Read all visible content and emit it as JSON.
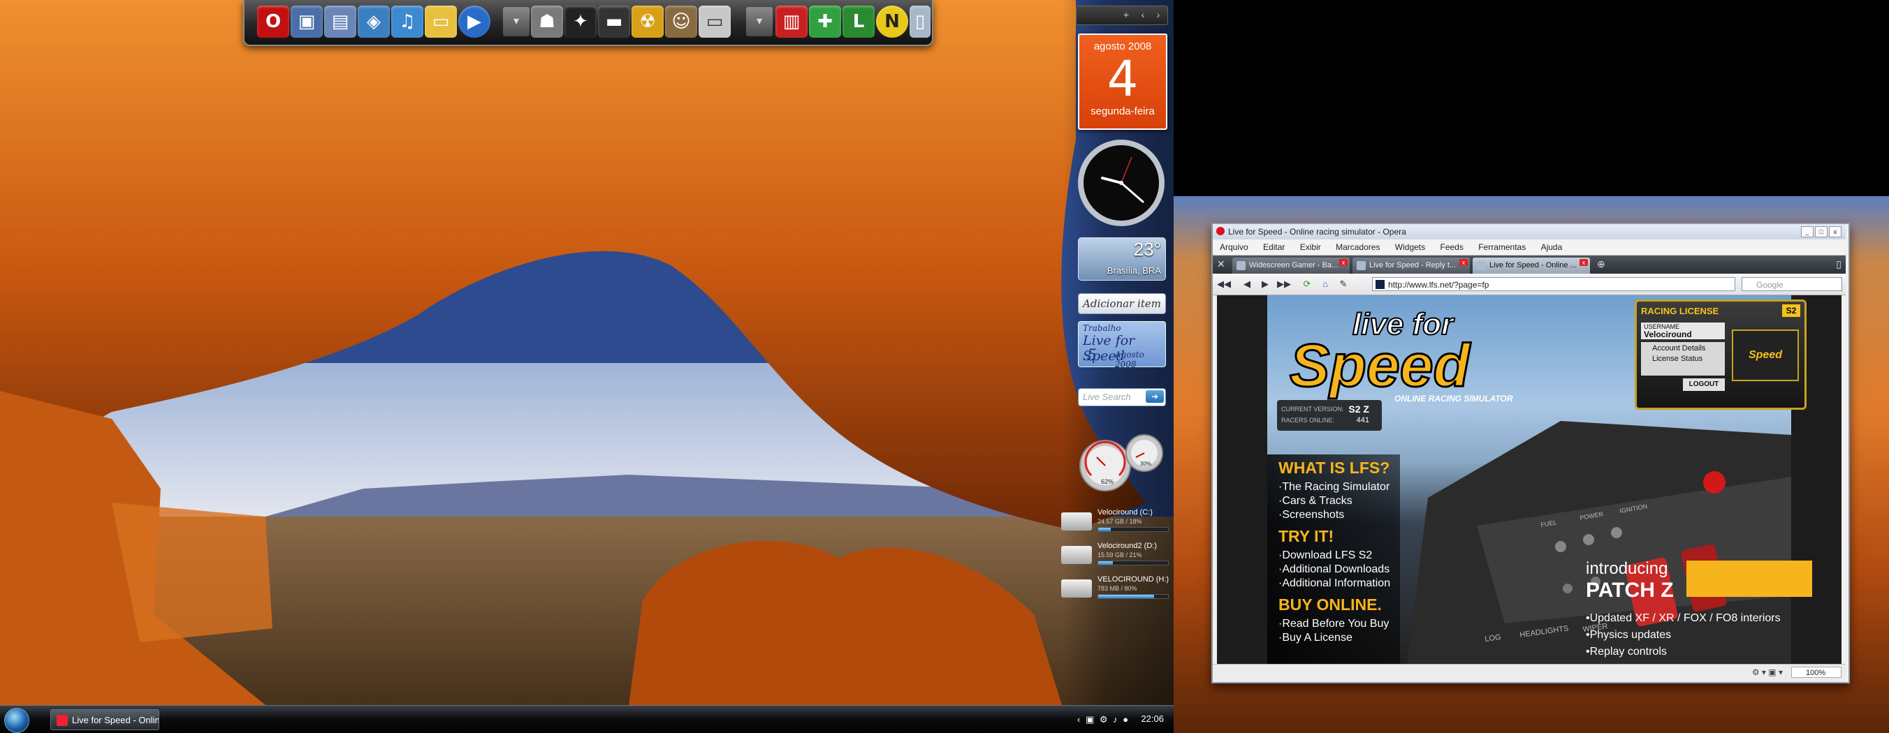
{
  "desktop": {
    "dock": {
      "icons": [
        "opera-icon",
        "computer-icon",
        "documents-icon",
        "media-icon",
        "music-icon",
        "folder-icon",
        "media-player-icon",
        "separator",
        "game-icon",
        "battlefield-icon",
        "racing-game-icon",
        "speed-icon",
        "radiation-icon",
        "character-icon",
        "drive-icon",
        "separator",
        "winamp-icon",
        "puzzle-icon",
        "program-icon",
        "norton-icon",
        "recycle-bin-icon"
      ]
    },
    "sidebar": {
      "top_controls": [
        "+",
        "‹",
        "›"
      ],
      "calendar": {
        "month": "agosto 2008",
        "day": "4",
        "weekday": "segunda-feira"
      },
      "weather": {
        "temp": "23°",
        "city": "Brasília, BRA"
      },
      "add_item": "Adicionar item",
      "note": {
        "title": "Trabalho",
        "line": "Live for Speed",
        "num": "5",
        "date": "Agosto 2008"
      },
      "live_search_placeholder": "Live Search",
      "gauges": {
        "cpu": "62%",
        "ram": "30%"
      },
      "drives": [
        {
          "name": "Velociround (C:)",
          "size": "24.57 GB / 18%",
          "usage": 0.18
        },
        {
          "name": "Velociround2 (D:)",
          "size": "15.59 GB / 21%",
          "usage": 0.21
        },
        {
          "name": "VELOCIROUND (H:)",
          "size": "783 MB / 80%",
          "usage": 0.8
        }
      ]
    },
    "taskbar": {
      "task_label": "Live for Speed - Onlin...",
      "clock": "22:06"
    }
  },
  "browser": {
    "title": "Live for Speed - Online racing simulator - Opera",
    "menu": [
      "Arquivo",
      "Editar",
      "Exibir",
      "Marcadores",
      "Widgets",
      "Feeds",
      "Ferramentas",
      "Ajuda"
    ],
    "tabs": [
      {
        "label": "Widescreen Gamer - Ba..."
      },
      {
        "label": "Live for Speed - Reply t..."
      },
      {
        "label": "Live for Speed - Online ..."
      }
    ],
    "url": "http://www.lfs.net/?page=fp",
    "search_placeholder": "Google",
    "zoom": "100%"
  },
  "lfs": {
    "logo_top": "live for",
    "logo_main": "Speed",
    "tagline": "ONLINE RACING SIMULATOR",
    "current_version_label": "CURRENT VERSION:",
    "current_version": "S2 Z",
    "racers_label": "RACERS ONLINE:",
    "racers": "441",
    "sections": [
      {
        "title": "WHAT IS LFS?",
        "links": [
          "·The Racing Simulator",
          "·Cars & Tracks",
          "·Screenshots"
        ]
      },
      {
        "title": "TRY IT!",
        "links": [
          "·Download LFS S2",
          "·Additional Downloads",
          "·Additional Information"
        ]
      },
      {
        "title": "BUY ONLINE.",
        "links": [
          "·Read Before You Buy",
          "·Buy A License"
        ]
      }
    ],
    "license": {
      "title": "RACING LICENSE",
      "badge": "S2",
      "username_label": "USERNAME",
      "username": "Velociround",
      "links": [
        "Account Details",
        "License Status"
      ],
      "logout": "LOGOUT",
      "mini_logo": "Speed"
    },
    "patch": {
      "intro": "introducing",
      "title": "PATCH Z",
      "items": [
        "•Updated XF / XR / FOX / FO8 interiors",
        "•Physics updates",
        "•Replay controls"
      ]
    },
    "dash_labels": [
      "FUEL",
      "POWER",
      "IGNITION",
      "LOG",
      "HEADLIGHTS",
      "WIPER"
    ]
  },
  "colors": {
    "lfs_yellow": "#f6b51c",
    "calendar_orange": "#e8500e",
    "opera_red": "#d11a1a"
  }
}
